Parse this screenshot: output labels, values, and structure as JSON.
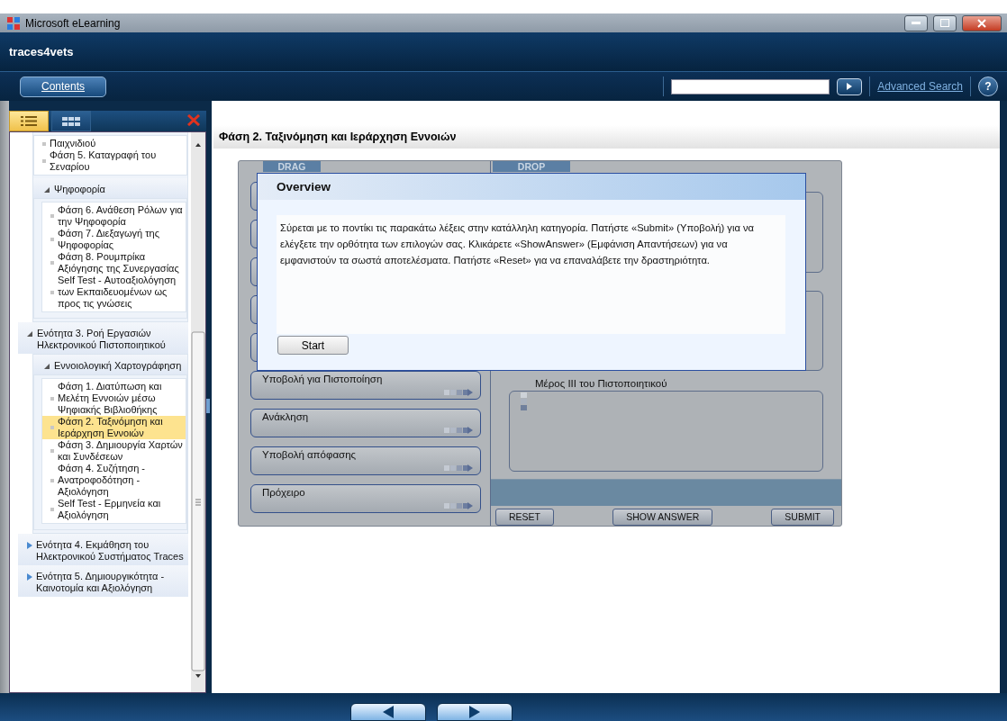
{
  "window": {
    "title": "Microsoft eLearning"
  },
  "app": {
    "title": "traces4vets"
  },
  "toolbar": {
    "contents_button": "Contents",
    "advanced_search": "Advanced Search",
    "help": "?"
  },
  "sidebar": {
    "tabs": [
      {
        "kind": "list",
        "selected": true
      },
      {
        "kind": "grid",
        "selected": false
      }
    ],
    "tree": [
      {
        "children": [
          {
            "label": "Παιχνιδιού",
            "selected": false
          },
          {
            "label": "Φάση 5. Καταγραφή του Σεναρίου",
            "selected": false
          },
          {
            "label": "Ψηφοφορία",
            "expanded": true,
            "children": [
              {
                "label": "Φάση 6. Ανάθεση Ρόλων για την Ψηφοφορία",
                "selected": false
              },
              {
                "label": "Φάση 7. Διεξαγωγή της Ψηφοφορίας",
                "selected": false
              },
              {
                "label": "Φάση 8. Ρουμπρίκα Αξιόγησης της Συνεργασίας",
                "selected": false
              },
              {
                "label": "Self Test - Αυτοαξιολόγηση των Εκπαιδευομένων ως προς τις γνώσεις",
                "selected": false
              }
            ]
          }
        ]
      },
      {
        "label": "Ενότητα 3. Ροή Εργασιών Ηλεκτρονικού Πιστοποιητικού",
        "expanded": true,
        "children": [
          {
            "label": "Εννοιολογική Χαρτογράφηση",
            "expanded": true,
            "children": [
              {
                "label": "Φάση 1. Διατύπωση και Μελέτη Εννοιών μέσω Ψηφιακής Βιβλιοθήκης",
                "selected": false
              },
              {
                "label": "Φάση 2. Ταξινόμηση και Ιεράρχηση Εννοιών",
                "selected": true
              },
              {
                "label": "Φάση 3. Δημιουργία Χαρτών και Συνδέσεων",
                "selected": false
              },
              {
                "label": "Φάση 4. Συζήτηση - Ανατροφοδότηση - Αξιολόγηση",
                "selected": false
              },
              {
                "label": "Self Test - Ερμηνεία και Αξιολόγηση",
                "selected": false
              }
            ]
          }
        ]
      },
      {
        "label": "Ενότητα 4. Εκμάθηση του Ηλεκτρονικού Συστήματος Traces",
        "expanded": false
      },
      {
        "label": "Ενότητα 5. Δημιουργικότητα - Καινοτομία και Αξιολόγηση",
        "expanded": false
      }
    ]
  },
  "content": {
    "title": "Φάση 2. Ταξινόμηση και Ιεράρχηση Εννοιών",
    "activity": {
      "drag_header": "DRAG",
      "drop_header": "DROP",
      "drag_items": [
        "Υποβολή για Πιστοποίηση",
        "Ανάκληση",
        "Υποβολή απόφασης",
        "Πρόχειρο"
      ],
      "drop_zones": [
        {
          "label": "Μέρος III του Πιστοποιητικού"
        }
      ],
      "buttons": [
        "RESET",
        "SHOW ANSWER",
        "SUBMIT"
      ]
    },
    "dialog": {
      "title": "Overview",
      "text": "Σύρεται με το ποντίκι τις παρακάτω λέξεις στην κατάλληλη κατηγορία. Πατήστε «Submit» (Υποβολή) για να ελέγξετε την ορθότητα των επιλογών σας. Κλικάρετε «ShowAnswer» (Εμφάνιση Απαντήσεων) για να εμφανιστούν τα σωστά αποτελέσματα. Πατήστε «Reset» για να επαναλάβετε την δραστηριότητα.",
      "button": "Start"
    }
  }
}
